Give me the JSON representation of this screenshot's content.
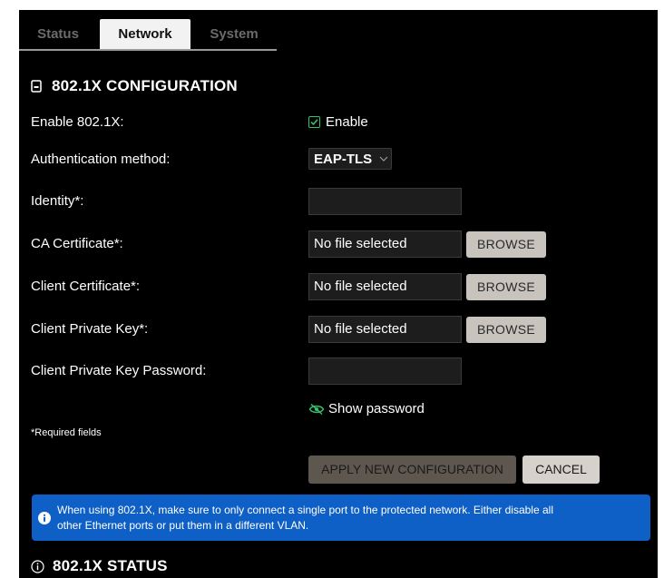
{
  "tabs": [
    {
      "label": "Status"
    },
    {
      "label": "Network"
    },
    {
      "label": "System"
    }
  ],
  "config_section": {
    "title": "802.1X CONFIGURATION",
    "icon": "id-card-icon"
  },
  "fields": {
    "enable": {
      "label": "Enable 802.1X:",
      "checkbox_label": "Enable",
      "checked": true
    },
    "auth_method": {
      "label": "Authentication method:",
      "value": "EAP-TLS"
    },
    "identity": {
      "label": "Identity*:",
      "value": ""
    },
    "ca_cert": {
      "label": "CA Certificate*:",
      "value": "No file selected",
      "button": "BROWSE"
    },
    "client_cert": {
      "label": "Client Certificate*:",
      "value": "No file selected",
      "button": "BROWSE"
    },
    "client_key": {
      "label": "Client Private Key*:",
      "value": "No file selected",
      "button": "BROWSE"
    },
    "client_key_password": {
      "label": "Client Private Key Password:",
      "value": ""
    }
  },
  "show_password": {
    "label": "Show password",
    "icon": "eye-slash-icon"
  },
  "required_note": "*Required fields",
  "actions": {
    "apply": "APPLY NEW CONFIGURATION",
    "cancel": "CANCEL"
  },
  "info_banner": {
    "icon": "info-icon",
    "line1": "When using 802.1X, make sure to only connect a single port to the protected network. Either disable all",
    "line2": "other Ethernet ports or put them in a different VLAN."
  },
  "status_section": {
    "title": "802.1X STATUS",
    "icon": "info-circle-icon"
  },
  "colors": {
    "background": "#000000",
    "check_green": "#2fc46b",
    "info_blue": "#0e5fc6",
    "browse_button": "#c8c3bd",
    "apply_button_disabled": "#5e5750"
  }
}
